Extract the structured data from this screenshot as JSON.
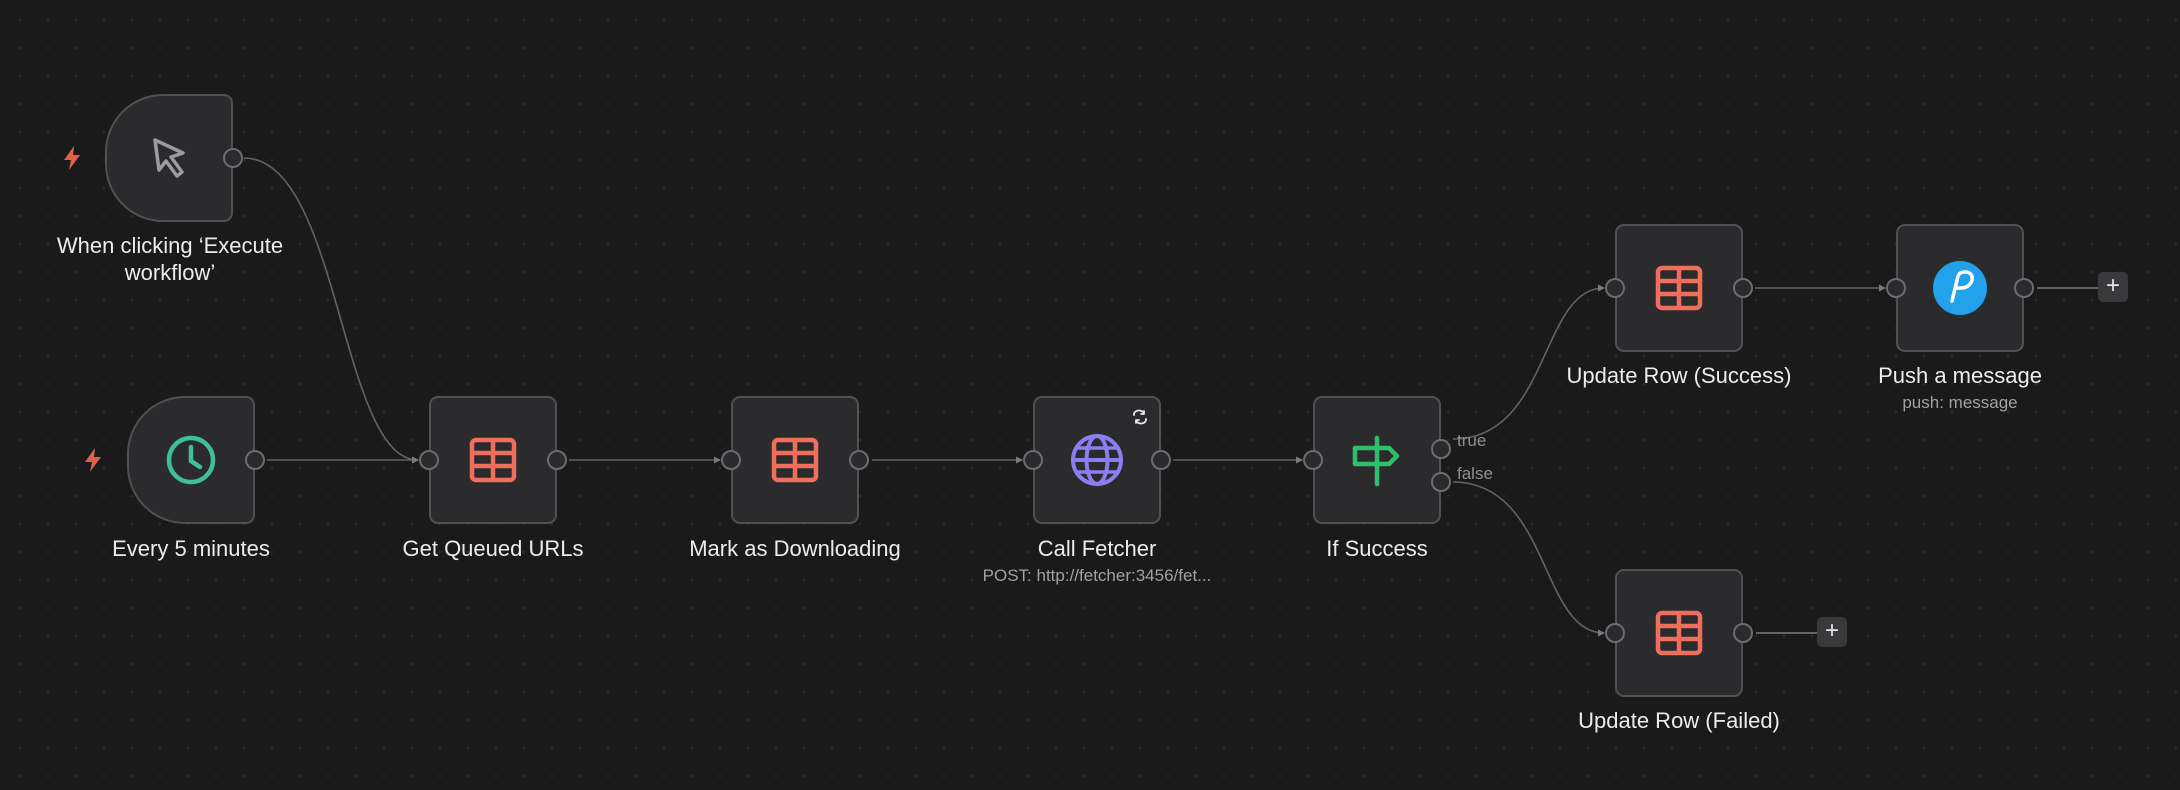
{
  "canvas": {
    "background": "#1a1a1b",
    "node_background": "#2b2b2d",
    "accent_colors": {
      "trigger_bolt": "#e3614a",
      "table_icon": "#ef6f5c",
      "clock_icon": "#3ebf96",
      "globe_icon": "#8c7ef0",
      "if_icon": "#2fbf6a",
      "pushbullet_icon": "#22a2ea"
    }
  },
  "nodes": {
    "manual_trigger": {
      "label": "When clicking ‘Execute workflow’",
      "icon": "cursor-icon"
    },
    "schedule_trigger": {
      "label": "Every 5 minutes",
      "icon": "clock-icon"
    },
    "get_queued_urls": {
      "label": "Get Queued URLs",
      "icon": "table-icon"
    },
    "mark_downloading": {
      "label": "Mark as Downloading",
      "icon": "table-icon"
    },
    "call_fetcher": {
      "label": "Call Fetcher",
      "subtitle": "POST: http://fetcher:3456/fet...",
      "icon": "globe-icon",
      "badge": "retry-icon"
    },
    "if_success": {
      "label": "If Success",
      "icon": "signpost-icon",
      "outputs": {
        "true": "true",
        "false": "false"
      }
    },
    "update_success": {
      "label": "Update Row (Success)",
      "icon": "table-icon"
    },
    "push_message": {
      "label": "Push a message",
      "subtitle": "push: message",
      "icon": "pushbullet-icon"
    },
    "update_failed": {
      "label": "Update Row (Failed)",
      "icon": "table-icon"
    }
  },
  "add_button": {
    "symbol": "+"
  }
}
